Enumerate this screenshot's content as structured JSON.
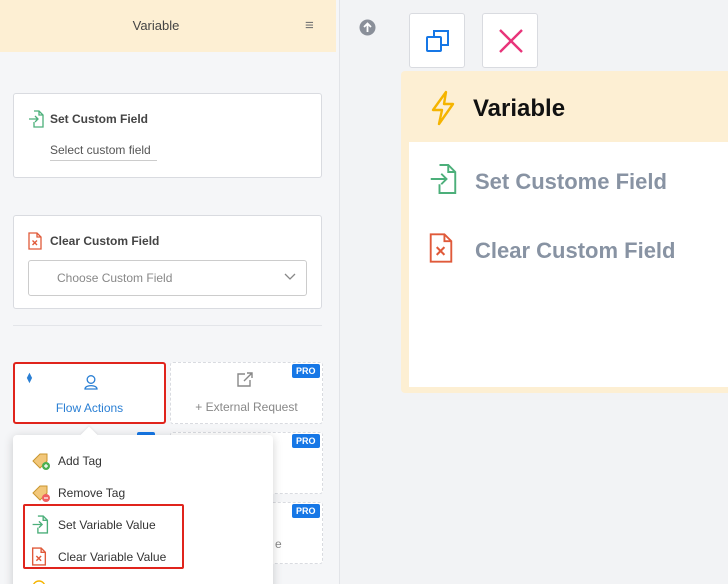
{
  "sidebar_header": {
    "title": "Variable",
    "menu_icon": "hamburger-icon"
  },
  "set_custom_field": {
    "title": "Set Custom Field",
    "value": "Select custom field"
  },
  "clear_custom_field": {
    "title": "Clear Custom Field",
    "placeholder": "Choose Custom Field"
  },
  "tiles": {
    "flow_actions": {
      "label": "Flow Actions"
    },
    "external_request": {
      "label": "+ External Request",
      "badge": "PRO"
    },
    "hidden_tile_1": {
      "badge": "PRO"
    },
    "hidden_tile_2": {
      "badge": "PRO",
      "partial_text": "e"
    }
  },
  "dropdown": {
    "items": [
      {
        "label": "Add Tag"
      },
      {
        "label": "Remove Tag"
      },
      {
        "label": "Set Variable Value"
      },
      {
        "label": "Clear Variable Value"
      }
    ]
  },
  "node": {
    "title": "Variable",
    "items": [
      {
        "label": "Set Custome Field"
      },
      {
        "label": "Clear Custom Field"
      }
    ]
  },
  "colors": {
    "header_bg": "#fdefd3",
    "accent_blue": "#2a7fd4",
    "pro_badge": "#1677e6",
    "highlight_red": "#e0241c",
    "set_green": "#4caf7a",
    "clear_red": "#e05a3a",
    "bolt_yellow": "#f5b400"
  }
}
